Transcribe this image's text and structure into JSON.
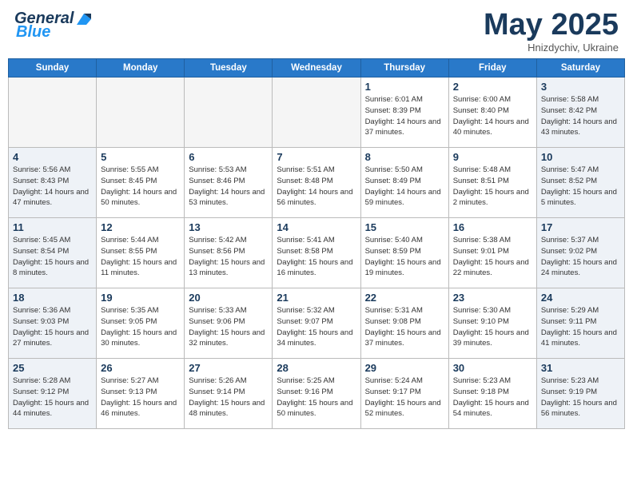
{
  "header": {
    "logo_general": "General",
    "logo_blue": "Blue",
    "title": "May 2025",
    "location": "Hnizdychiv, Ukraine"
  },
  "days_of_week": [
    "Sunday",
    "Monday",
    "Tuesday",
    "Wednesday",
    "Thursday",
    "Friday",
    "Saturday"
  ],
  "weeks": [
    [
      {
        "day": "",
        "empty": true
      },
      {
        "day": "",
        "empty": true
      },
      {
        "day": "",
        "empty": true
      },
      {
        "day": "",
        "empty": true
      },
      {
        "day": "1",
        "sunrise": "6:01 AM",
        "sunset": "8:39 PM",
        "daylight": "14 hours and 37 minutes."
      },
      {
        "day": "2",
        "sunrise": "6:00 AM",
        "sunset": "8:40 PM",
        "daylight": "14 hours and 40 minutes."
      },
      {
        "day": "3",
        "sunrise": "5:58 AM",
        "sunset": "8:42 PM",
        "daylight": "14 hours and 43 minutes.",
        "weekend": true
      }
    ],
    [
      {
        "day": "4",
        "sunrise": "5:56 AM",
        "sunset": "8:43 PM",
        "daylight": "14 hours and 47 minutes.",
        "weekend": true
      },
      {
        "day": "5",
        "sunrise": "5:55 AM",
        "sunset": "8:45 PM",
        "daylight": "14 hours and 50 minutes."
      },
      {
        "day": "6",
        "sunrise": "5:53 AM",
        "sunset": "8:46 PM",
        "daylight": "14 hours and 53 minutes."
      },
      {
        "day": "7",
        "sunrise": "5:51 AM",
        "sunset": "8:48 PM",
        "daylight": "14 hours and 56 minutes."
      },
      {
        "day": "8",
        "sunrise": "5:50 AM",
        "sunset": "8:49 PM",
        "daylight": "14 hours and 59 minutes."
      },
      {
        "day": "9",
        "sunrise": "5:48 AM",
        "sunset": "8:51 PM",
        "daylight": "15 hours and 2 minutes."
      },
      {
        "day": "10",
        "sunrise": "5:47 AM",
        "sunset": "8:52 PM",
        "daylight": "15 hours and 5 minutes.",
        "weekend": true
      }
    ],
    [
      {
        "day": "11",
        "sunrise": "5:45 AM",
        "sunset": "8:54 PM",
        "daylight": "15 hours and 8 minutes.",
        "weekend": true
      },
      {
        "day": "12",
        "sunrise": "5:44 AM",
        "sunset": "8:55 PM",
        "daylight": "15 hours and 11 minutes."
      },
      {
        "day": "13",
        "sunrise": "5:42 AM",
        "sunset": "8:56 PM",
        "daylight": "15 hours and 13 minutes."
      },
      {
        "day": "14",
        "sunrise": "5:41 AM",
        "sunset": "8:58 PM",
        "daylight": "15 hours and 16 minutes."
      },
      {
        "day": "15",
        "sunrise": "5:40 AM",
        "sunset": "8:59 PM",
        "daylight": "15 hours and 19 minutes."
      },
      {
        "day": "16",
        "sunrise": "5:38 AM",
        "sunset": "9:01 PM",
        "daylight": "15 hours and 22 minutes."
      },
      {
        "day": "17",
        "sunrise": "5:37 AM",
        "sunset": "9:02 PM",
        "daylight": "15 hours and 24 minutes.",
        "weekend": true
      }
    ],
    [
      {
        "day": "18",
        "sunrise": "5:36 AM",
        "sunset": "9:03 PM",
        "daylight": "15 hours and 27 minutes.",
        "weekend": true
      },
      {
        "day": "19",
        "sunrise": "5:35 AM",
        "sunset": "9:05 PM",
        "daylight": "15 hours and 30 minutes."
      },
      {
        "day": "20",
        "sunrise": "5:33 AM",
        "sunset": "9:06 PM",
        "daylight": "15 hours and 32 minutes."
      },
      {
        "day": "21",
        "sunrise": "5:32 AM",
        "sunset": "9:07 PM",
        "daylight": "15 hours and 34 minutes."
      },
      {
        "day": "22",
        "sunrise": "5:31 AM",
        "sunset": "9:08 PM",
        "daylight": "15 hours and 37 minutes."
      },
      {
        "day": "23",
        "sunrise": "5:30 AM",
        "sunset": "9:10 PM",
        "daylight": "15 hours and 39 minutes."
      },
      {
        "day": "24",
        "sunrise": "5:29 AM",
        "sunset": "9:11 PM",
        "daylight": "15 hours and 41 minutes.",
        "weekend": true
      }
    ],
    [
      {
        "day": "25",
        "sunrise": "5:28 AM",
        "sunset": "9:12 PM",
        "daylight": "15 hours and 44 minutes.",
        "weekend": true
      },
      {
        "day": "26",
        "sunrise": "5:27 AM",
        "sunset": "9:13 PM",
        "daylight": "15 hours and 46 minutes."
      },
      {
        "day": "27",
        "sunrise": "5:26 AM",
        "sunset": "9:14 PM",
        "daylight": "15 hours and 48 minutes."
      },
      {
        "day": "28",
        "sunrise": "5:25 AM",
        "sunset": "9:16 PM",
        "daylight": "15 hours and 50 minutes."
      },
      {
        "day": "29",
        "sunrise": "5:24 AM",
        "sunset": "9:17 PM",
        "daylight": "15 hours and 52 minutes."
      },
      {
        "day": "30",
        "sunrise": "5:23 AM",
        "sunset": "9:18 PM",
        "daylight": "15 hours and 54 minutes."
      },
      {
        "day": "31",
        "sunrise": "5:23 AM",
        "sunset": "9:19 PM",
        "daylight": "15 hours and 56 minutes.",
        "weekend": true
      }
    ]
  ]
}
